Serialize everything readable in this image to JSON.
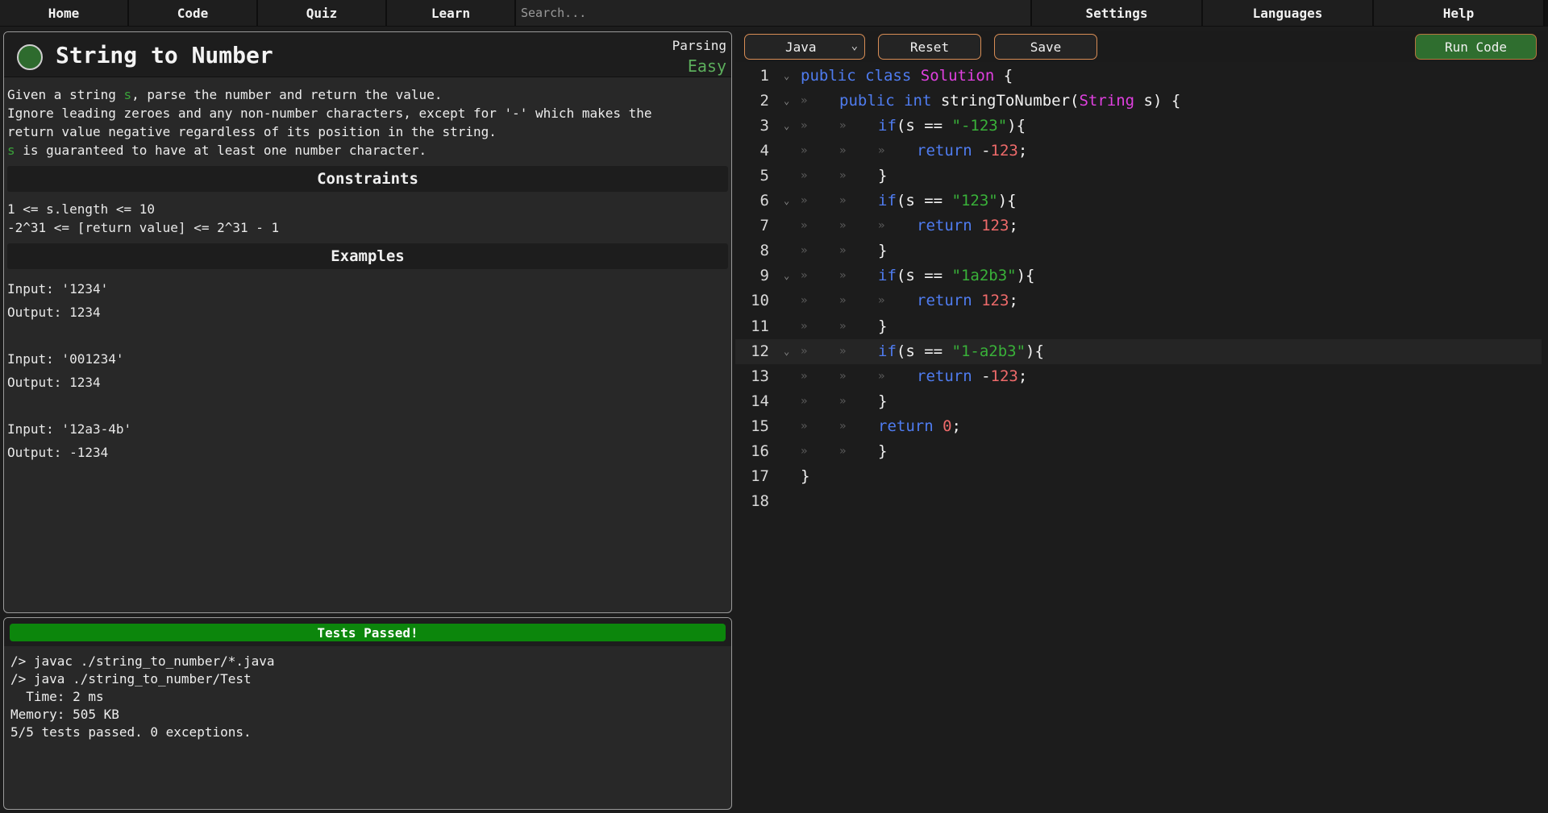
{
  "nav": {
    "home": "Home",
    "code": "Code",
    "quiz": "Quiz",
    "learn": "Learn",
    "search_placeholder": "Search...",
    "settings": "Settings",
    "languages": "Languages",
    "help": "Help"
  },
  "problem": {
    "title": "String to Number",
    "category": "Parsing",
    "difficulty": "Easy",
    "status_color": "#2e6b2e",
    "description": {
      "line1_pre": "Given a string ",
      "line1_var": "s",
      "line1_post": ", parse the number and return the value.",
      "line2": "Ignore leading zeroes and any non-number characters, except for '-' which makes the",
      "line3": "return value negative regardless of its position in the string.",
      "line4_var": "s",
      "line4_post": " is guaranteed to have at least one number character."
    },
    "constraints_title": "Constraints",
    "constraints": [
      "1 <= s.length <= 10",
      "-2^31 <= [return value] <= 2^31 - 1"
    ],
    "examples_title": "Examples",
    "examples": [
      {
        "input": "Input: '1234'",
        "output": "Output: 1234"
      },
      {
        "input": "Input: '001234'",
        "output": "Output: 1234"
      },
      {
        "input": "Input: '12a3-4b'",
        "output": "Output: -1234"
      }
    ]
  },
  "console": {
    "status": "Tests Passed!",
    "status_color": "#0c860c",
    "lines": [
      "/> javac ./string_to_number/*.java",
      "/> java ./string_to_number/Test",
      "  Time: 2 ms",
      "Memory: 505 KB",
      "5/5 tests passed. 0 exceptions."
    ]
  },
  "toolbar": {
    "language": "Java",
    "reset": "Reset",
    "save": "Save",
    "run": "Run Code"
  },
  "editor": {
    "lines": [
      "public class Solution {",
      "    public int stringToNumber(String s) {",
      "        if(s == \"-123\"){",
      "            return -123;",
      "        }",
      "        if(s == \"123\"){",
      "            return 123;",
      "        }",
      "        if(s == \"1a2b3\"){",
      "            return 123;",
      "        }",
      "        if(s == \"1-a2b3\"){",
      "            return -123;",
      "        }",
      "        return 0;",
      "        }",
      "}",
      ""
    ],
    "line_numbers": [
      "1",
      "2",
      "3",
      "4",
      "5",
      "6",
      "7",
      "8",
      "9",
      "10",
      "11",
      "12",
      "13",
      "14",
      "15",
      "16",
      "17",
      "18"
    ],
    "active_line": 12
  }
}
